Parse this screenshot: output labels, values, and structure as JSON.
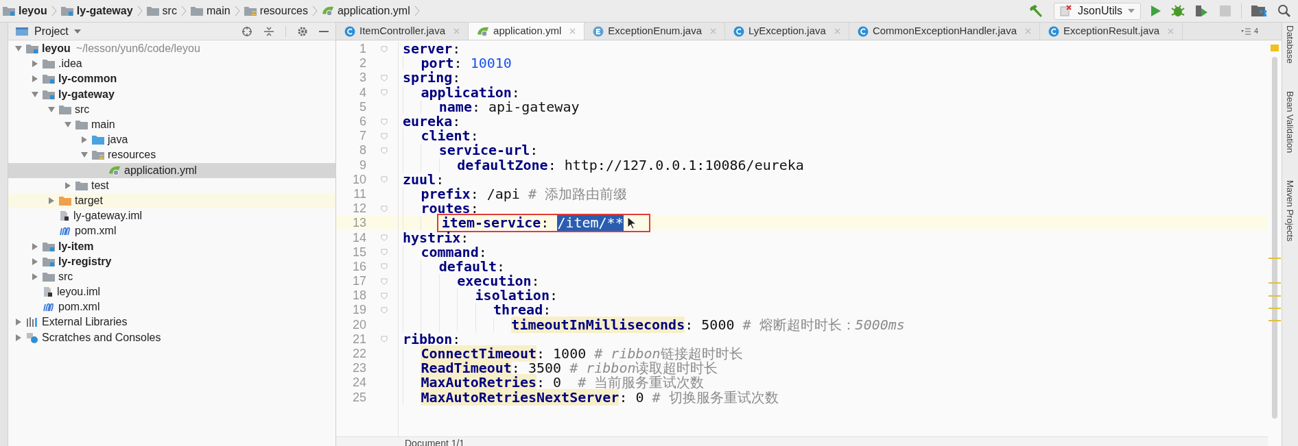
{
  "breadcrumbs": [
    {
      "label": "leyou",
      "kind": "module"
    },
    {
      "label": "ly-gateway",
      "kind": "module"
    },
    {
      "label": "src",
      "kind": "folder"
    },
    {
      "label": "main",
      "kind": "folder"
    },
    {
      "label": "resources",
      "kind": "resources"
    },
    {
      "label": "application.yml",
      "kind": "yml"
    }
  ],
  "toolbar": {
    "run_config": "JsonUtils",
    "stop_disabled": true
  },
  "project_panel": {
    "title": "Project",
    "tree": [
      {
        "label": "leyou",
        "hint": "~/lesson/yun6/code/leyou",
        "kind": "module",
        "expanded": true,
        "selected": false,
        "highlighted": false,
        "children": [
          {
            "label": ".idea",
            "kind": "folder",
            "expanded": false,
            "selected": false,
            "highlighted": false
          },
          {
            "label": "ly-common",
            "kind": "module",
            "expanded": false,
            "selected": false,
            "highlighted": false
          },
          {
            "label": "ly-gateway",
            "kind": "module",
            "expanded": true,
            "selected": false,
            "highlighted": false,
            "children": [
              {
                "label": "src",
                "kind": "folder",
                "expanded": true,
                "selected": false,
                "highlighted": false,
                "children": [
                  {
                    "label": "main",
                    "kind": "folder",
                    "expanded": true,
                    "selected": false,
                    "highlighted": false,
                    "children": [
                      {
                        "label": "java",
                        "kind": "source",
                        "expanded": false,
                        "selected": false,
                        "highlighted": false
                      },
                      {
                        "label": "resources",
                        "kind": "resources",
                        "expanded": true,
                        "selected": false,
                        "highlighted": false,
                        "children": [
                          {
                            "label": "application.yml",
                            "kind": "yml",
                            "selected": true,
                            "highlighted": false
                          }
                        ]
                      }
                    ]
                  },
                  {
                    "label": "test",
                    "kind": "folder",
                    "expanded": false,
                    "selected": false,
                    "highlighted": false
                  }
                ]
              },
              {
                "label": "target",
                "kind": "excluded",
                "expanded": false,
                "selected": false,
                "highlighted": true
              },
              {
                "label": "ly-gateway.iml",
                "kind": "iml",
                "selected": false,
                "highlighted": false
              },
              {
                "label": "pom.xml",
                "kind": "maven",
                "selected": false,
                "highlighted": false
              }
            ]
          },
          {
            "label": "ly-item",
            "kind": "module",
            "expanded": false,
            "selected": false,
            "highlighted": false
          },
          {
            "label": "ly-registry",
            "kind": "module",
            "expanded": false,
            "selected": false,
            "highlighted": false
          },
          {
            "label": "src",
            "kind": "folder",
            "expanded": false,
            "selected": false,
            "highlighted": false
          },
          {
            "label": "leyou.iml",
            "kind": "iml",
            "selected": false,
            "highlighted": false
          },
          {
            "label": "pom.xml",
            "kind": "maven",
            "selected": false,
            "highlighted": false
          }
        ]
      },
      {
        "label": "External Libraries",
        "kind": "libraries",
        "expanded": false,
        "selected": false,
        "highlighted": false
      },
      {
        "label": "Scratches and Consoles",
        "kind": "scratches",
        "expanded": false,
        "selected": false,
        "highlighted": false
      }
    ]
  },
  "tabs": [
    {
      "label": "ItemController.java",
      "kind": "class",
      "selected": false
    },
    {
      "label": "application.yml",
      "kind": "yml",
      "selected": true
    },
    {
      "label": "ExceptionEnum.java",
      "kind": "enum",
      "selected": false
    },
    {
      "label": "LyException.java",
      "kind": "class",
      "selected": false
    },
    {
      "label": "CommonExceptionHandler.java",
      "kind": "class",
      "selected": false
    },
    {
      "label": "ExceptionResult.java",
      "kind": "class",
      "selected": false
    }
  ],
  "tab_overflow_count": "4",
  "editor": {
    "lines": [
      {
        "number": "1",
        "current": false,
        "boxed": false,
        "tokens": [
          {
            "kind": "key",
            "text": "server"
          },
          {
            "kind": "plain",
            "text": ":"
          }
        ],
        "children": [
          {
            "number": "2",
            "current": false,
            "boxed": false,
            "tokens": [
              {
                "kind": "key",
                "text": "port"
              },
              {
                "kind": "plain",
                "text": ": "
              },
              {
                "kind": "number",
                "text": "10010"
              }
            ]
          }
        ]
      },
      {
        "number": "3",
        "current": false,
        "boxed": false,
        "tokens": [
          {
            "kind": "key",
            "text": "spring"
          },
          {
            "kind": "plain",
            "text": ":"
          }
        ],
        "children": [
          {
            "number": "4",
            "current": false,
            "boxed": false,
            "tokens": [
              {
                "kind": "key",
                "text": "application"
              },
              {
                "kind": "plain",
                "text": ":"
              }
            ],
            "children": [
              {
                "number": "5",
                "current": false,
                "boxed": false,
                "tokens": [
                  {
                    "kind": "key",
                    "text": "name"
                  },
                  {
                    "kind": "plain",
                    "text": ": api-gateway"
                  }
                ]
              }
            ]
          }
        ]
      },
      {
        "number": "6",
        "current": false,
        "boxed": false,
        "tokens": [
          {
            "kind": "key",
            "text": "eureka"
          },
          {
            "kind": "plain",
            "text": ":"
          }
        ],
        "children": [
          {
            "number": "7",
            "current": false,
            "boxed": false,
            "tokens": [
              {
                "kind": "key",
                "text": "client"
              },
              {
                "kind": "plain",
                "text": ":"
              }
            ],
            "children": [
              {
                "number": "8",
                "current": false,
                "boxed": false,
                "tokens": [
                  {
                    "kind": "key",
                    "text": "service-url"
                  },
                  {
                    "kind": "plain",
                    "text": ":"
                  }
                ],
                "children": [
                  {
                    "number": "9",
                    "current": false,
                    "boxed": false,
                    "tokens": [
                      {
                        "kind": "key",
                        "text": "defaultZone"
                      },
                      {
                        "kind": "plain",
                        "text": ": http://127.0.0.1:10086/eureka"
                      }
                    ]
                  }
                ]
              }
            ]
          }
        ]
      },
      {
        "number": "10",
        "current": false,
        "boxed": false,
        "tokens": [
          {
            "kind": "key",
            "text": "zuul"
          },
          {
            "kind": "plain",
            "text": ":"
          }
        ],
        "children": [
          {
            "number": "11",
            "current": false,
            "boxed": false,
            "tokens": [
              {
                "kind": "key",
                "text": "prefix"
              },
              {
                "kind": "plain",
                "text": ": /api "
              },
              {
                "kind": "comment",
                "text": "# 添加路由前缀"
              }
            ]
          },
          {
            "number": "12",
            "current": false,
            "boxed": false,
            "tokens": [
              {
                "kind": "key",
                "text": "routes"
              },
              {
                "kind": "plain",
                "text": ":"
              }
            ],
            "children": [
              {
                "number": "13",
                "current": true,
                "boxed": true,
                "tokens": [
                  {
                    "kind": "key",
                    "text": "item-service"
                  },
                  {
                    "kind": "plain",
                    "text": ": "
                  },
                  {
                    "kind": "selected",
                    "text": "/item/**"
                  }
                ]
              }
            ]
          }
        ]
      },
      {
        "number": "14",
        "current": false,
        "boxed": false,
        "tokens": [
          {
            "kind": "key",
            "text": "hystrix"
          },
          {
            "kind": "plain",
            "text": ":"
          }
        ],
        "children": [
          {
            "number": "15",
            "current": false,
            "boxed": false,
            "tokens": [
              {
                "kind": "key",
                "text": "command"
              },
              {
                "kind": "plain",
                "text": ":"
              }
            ],
            "children": [
              {
                "number": "16",
                "current": false,
                "boxed": false,
                "tokens": [
                  {
                    "kind": "key",
                    "text": "default"
                  },
                  {
                    "kind": "plain",
                    "text": ":"
                  }
                ],
                "children": [
                  {
                    "number": "17",
                    "current": false,
                    "boxed": false,
                    "tokens": [
                      {
                        "kind": "key",
                        "text": "execution"
                      },
                      {
                        "kind": "plain",
                        "text": ":"
                      }
                    ],
                    "children": [
                      {
                        "number": "18",
                        "current": false,
                        "boxed": false,
                        "tokens": [
                          {
                            "kind": "key",
                            "text": "isolation"
                          },
                          {
                            "kind": "plain",
                            "text": ":"
                          }
                        ],
                        "children": [
                          {
                            "number": "19",
                            "current": false,
                            "boxed": false,
                            "tokens": [
                              {
                                "kind": "key",
                                "text": "thread"
                              },
                              {
                                "kind": "plain",
                                "text": ":"
                              }
                            ],
                            "children": [
                              {
                                "number": "20",
                                "current": false,
                                "boxed": false,
                                "tokens": [
                                  {
                                    "kind": "key_warn",
                                    "text": "timeoutInMilliseconds"
                                  },
                                  {
                                    "kind": "plain",
                                    "text": ": 5000 "
                                  },
                                  {
                                    "kind": "comment",
                                    "text": "# 熔断超时时长："
                                  },
                                  {
                                    "kind": "comment_em",
                                    "text": "5000ms"
                                  }
                                ]
                              }
                            ]
                          }
                        ]
                      }
                    ]
                  }
                ]
              }
            ]
          }
        ]
      },
      {
        "number": "21",
        "current": false,
        "boxed": false,
        "tokens": [
          {
            "kind": "key",
            "text": "ribbon"
          },
          {
            "kind": "plain",
            "text": ":"
          }
        ],
        "children": [
          {
            "number": "22",
            "current": false,
            "boxed": false,
            "tokens": [
              {
                "kind": "key_warn",
                "text": "ConnectTimeout"
              },
              {
                "kind": "plain",
                "text": ": 1000 "
              },
              {
                "kind": "comment",
                "text": "# "
              },
              {
                "kind": "comment_em",
                "text": "ribbon"
              },
              {
                "kind": "comment",
                "text": "链接超时时长"
              }
            ]
          },
          {
            "number": "23",
            "current": false,
            "boxed": false,
            "tokens": [
              {
                "kind": "key_warn",
                "text": "ReadTimeout"
              },
              {
                "kind": "plain",
                "text": ": 3500 "
              },
              {
                "kind": "comment",
                "text": "# "
              },
              {
                "kind": "comment_em",
                "text": "ribbon"
              },
              {
                "kind": "comment",
                "text": "读取超时时长"
              }
            ]
          },
          {
            "number": "24",
            "current": false,
            "boxed": false,
            "tokens": [
              {
                "kind": "key_warn",
                "text": "MaxAutoRetries"
              },
              {
                "kind": "plain",
                "text": ": 0  "
              },
              {
                "kind": "comment",
                "text": "# 当前服务重试次数"
              }
            ]
          },
          {
            "number": "25",
            "current": false,
            "boxed": false,
            "tokens": [
              {
                "kind": "key_warn",
                "text": "MaxAutoRetriesNextServer"
              },
              {
                "kind": "plain",
                "text": ": 0 "
              },
              {
                "kind": "comment",
                "text": "# 切换服务重试次数"
              }
            ]
          }
        ]
      }
    ],
    "breadcrumb": "Document 1/1"
  },
  "right_tools": [
    "Database",
    "Bean Validation",
    "Maven Projects"
  ]
}
